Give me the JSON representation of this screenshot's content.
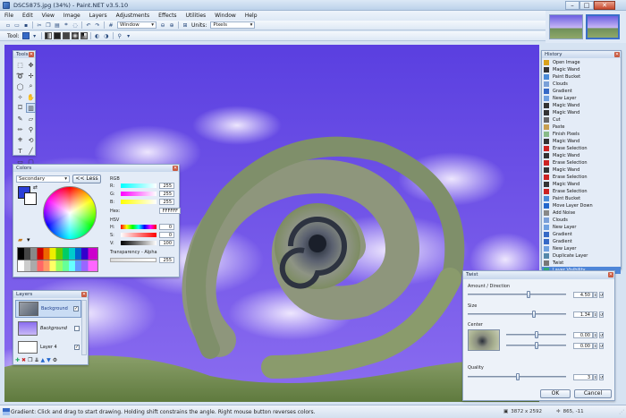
{
  "app": {
    "title": "DSC5875.jpg (34%) - Paint.NET v3.5.10"
  },
  "window_controls": {
    "minimize": "–",
    "maximize": "□",
    "close": "✕"
  },
  "menu": [
    "File",
    "Edit",
    "View",
    "Image",
    "Layers",
    "Adjustments",
    "Effects",
    "Utilities",
    "Window",
    "Help"
  ],
  "toolbar": {
    "zoom_combo": "Window",
    "units_label": "Units:",
    "units_value": "Pixels",
    "tool_label": "Tool:"
  },
  "tools_panel": {
    "title": "Tools",
    "close": "✕"
  },
  "colors_panel": {
    "title": "Colors",
    "close": "✕",
    "mode": "Secondary",
    "less_button": "<< Less",
    "rgb_label": "RGB",
    "r_label": "R:",
    "r_value": "255",
    "g_label": "G:",
    "g_value": "255",
    "b_label": "B:",
    "b_value": "255",
    "hex_label": "Hex:",
    "hex_value": "FFFFFF",
    "hsv_label": "HSV",
    "h_label": "H:",
    "h_value": "0",
    "s_label": "S:",
    "s_value": "0",
    "v_label": "V:",
    "v_value": "100",
    "transparency_label": "Transparency - Alpha",
    "alpha_value": "255",
    "primary_color": "#2b3fd8",
    "secondary_color": "#ffffff"
  },
  "history_panel": {
    "title": "History",
    "close": "✕",
    "items": [
      {
        "label": "Open Image",
        "icon": "open-image-icon"
      },
      {
        "label": "Magic Wand",
        "icon": "magic-wand-icon"
      },
      {
        "label": "Paint Bucket",
        "icon": "paint-bucket-icon"
      },
      {
        "label": "Clouds",
        "icon": "clouds-icon"
      },
      {
        "label": "Gradient",
        "icon": "gradient-icon"
      },
      {
        "label": "New Layer",
        "icon": "new-layer-icon"
      },
      {
        "label": "Magic Wand",
        "icon": "magic-wand-icon"
      },
      {
        "label": "Magic Wand",
        "icon": "magic-wand-icon"
      },
      {
        "label": "Cut",
        "icon": "cut-icon"
      },
      {
        "label": "Paste",
        "icon": "paste-icon"
      },
      {
        "label": "Finish Pixels",
        "icon": "finish-pixels-icon"
      },
      {
        "label": "Magic Wand",
        "icon": "magic-wand-icon"
      },
      {
        "label": "Erase Selection",
        "icon": "erase-selection-icon"
      },
      {
        "label": "Magic Wand",
        "icon": "magic-wand-icon"
      },
      {
        "label": "Erase Selection",
        "icon": "erase-selection-icon"
      },
      {
        "label": "Magic Wand",
        "icon": "magic-wand-icon"
      },
      {
        "label": "Erase Selection",
        "icon": "erase-selection-icon"
      },
      {
        "label": "Magic Wand",
        "icon": "magic-wand-icon"
      },
      {
        "label": "Erase Selection",
        "icon": "erase-selection-icon"
      },
      {
        "label": "Paint Bucket",
        "icon": "paint-bucket-icon"
      },
      {
        "label": "Move Layer Down",
        "icon": "move-layer-down-icon"
      },
      {
        "label": "Add Noise",
        "icon": "add-noise-icon"
      },
      {
        "label": "Clouds",
        "icon": "clouds-icon"
      },
      {
        "label": "New Layer",
        "icon": "new-layer-icon"
      },
      {
        "label": "Gradient",
        "icon": "gradient-icon"
      },
      {
        "label": "Gradient",
        "icon": "gradient-icon"
      },
      {
        "label": "New Layer",
        "icon": "new-layer-icon"
      },
      {
        "label": "Duplicate Layer",
        "icon": "duplicate-layer-icon"
      },
      {
        "label": "Twist",
        "icon": "twist-icon"
      },
      {
        "label": "Layer Visibility",
        "icon": "layer-visibility-icon"
      }
    ]
  },
  "layers_panel": {
    "title": "Layers",
    "close": "✕",
    "items": [
      {
        "label": "Background",
        "selected": true
      },
      {
        "label": "Background",
        "selected": false
      },
      {
        "label": "Layer 4",
        "selected": false
      }
    ]
  },
  "twist_dialog": {
    "title": "Twist",
    "close": "✕",
    "amount_label": "Amount / Direction",
    "amount_value": "4.50",
    "size_label": "Size",
    "size_value": "1.34",
    "center_label": "Center",
    "center_x_value": "0.00",
    "center_y_value": "0.00",
    "quality_label": "Quality",
    "quality_value": "3",
    "ok_label": "OK",
    "cancel_label": "Cancel",
    "reset": "↺"
  },
  "statusbar": {
    "text": "Gradient: Click and drag to start drawing. Holding shift constrains the angle. Right mouse button reverses colors.",
    "image_size": "3872 x 2592",
    "cursor_position": "865, -11"
  }
}
